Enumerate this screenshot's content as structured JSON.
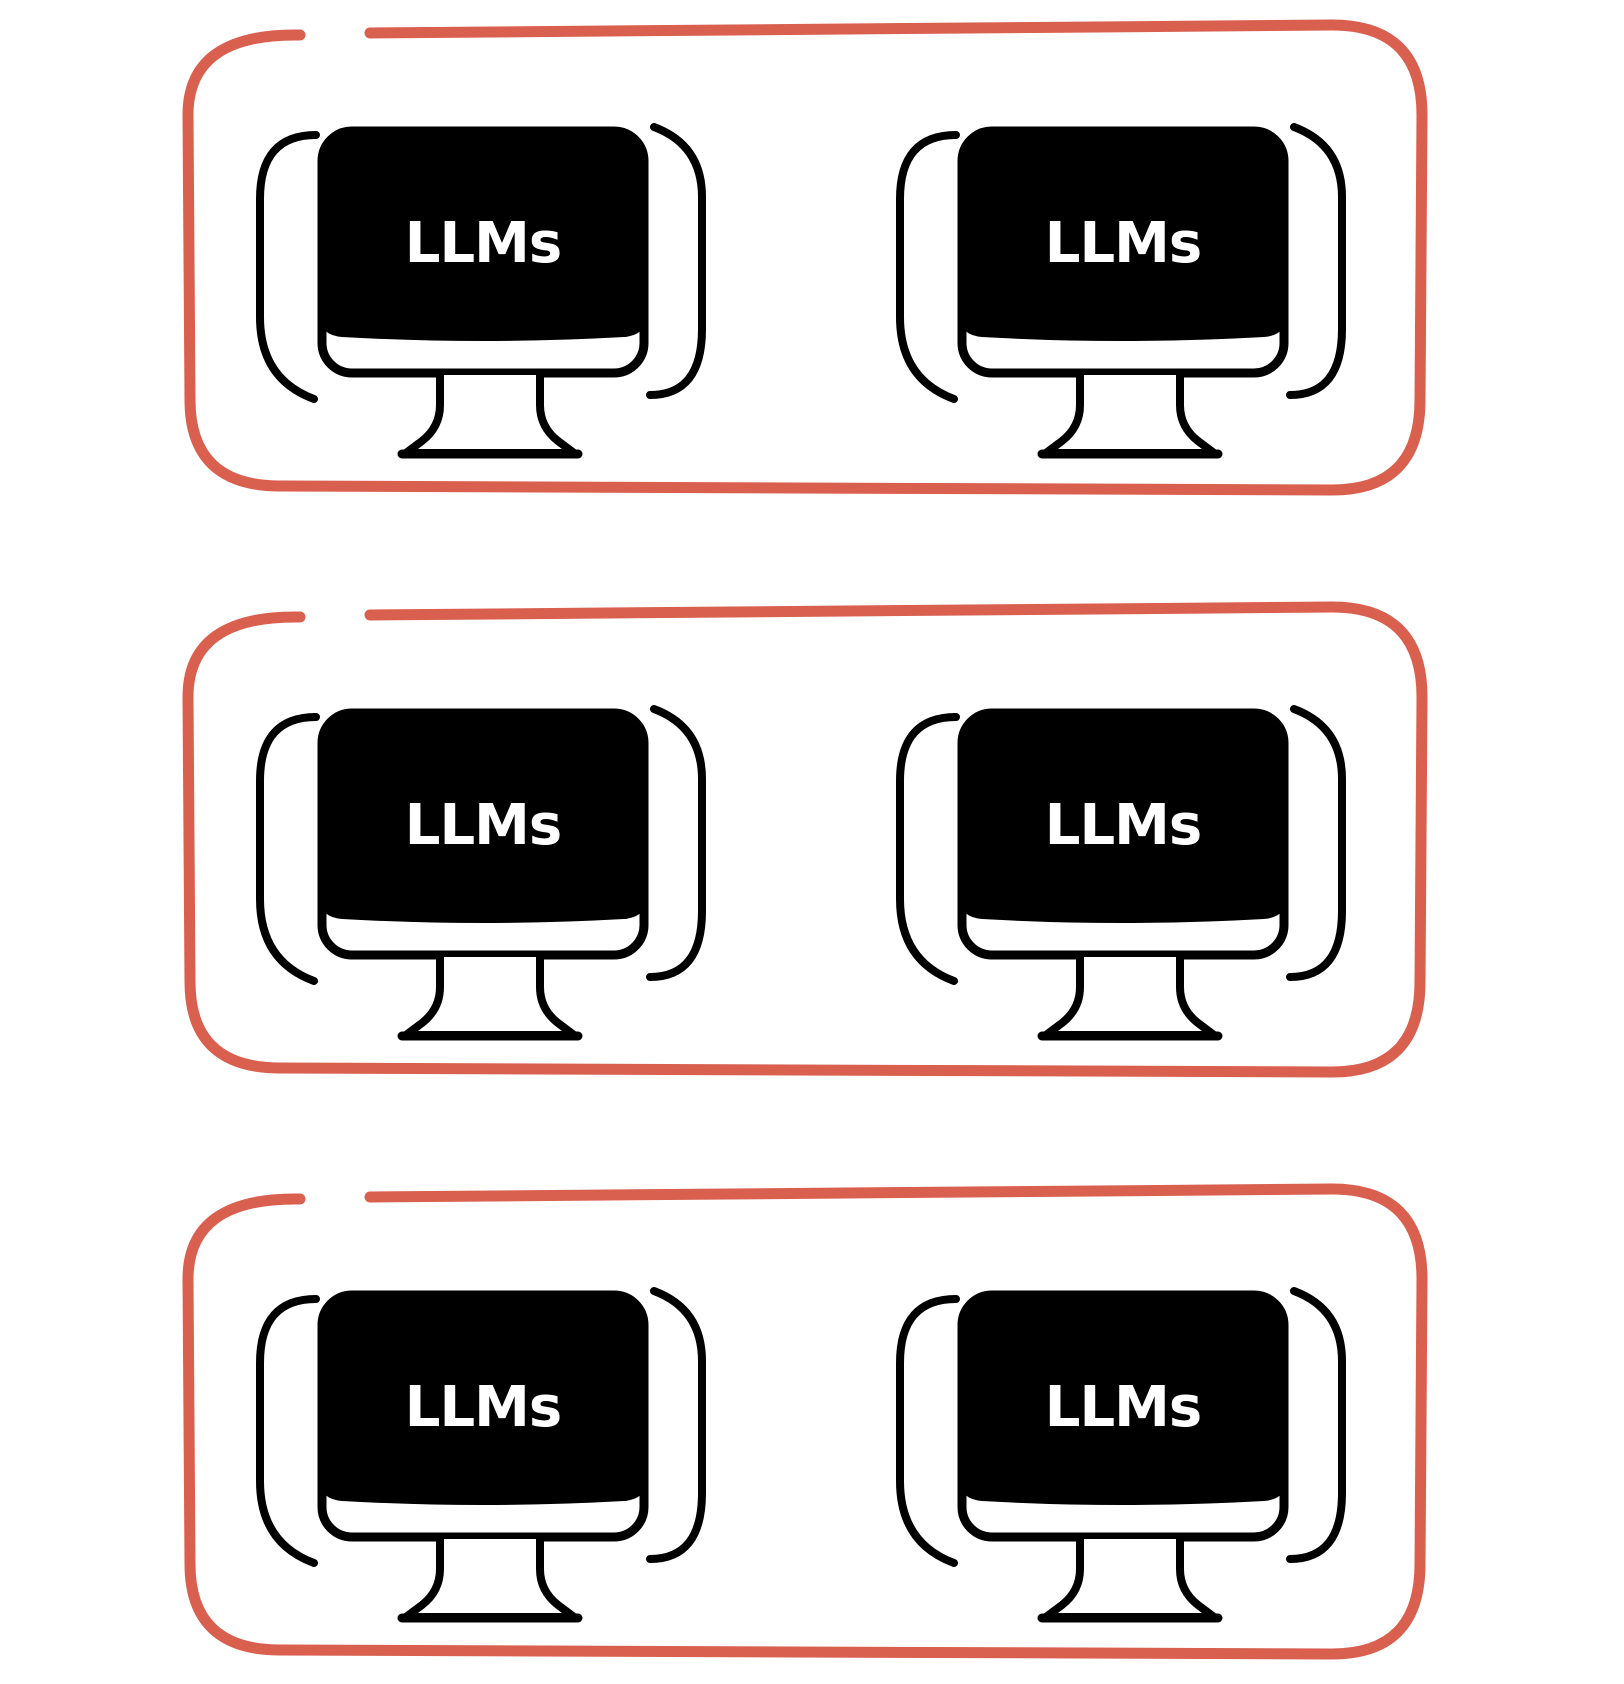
{
  "colors": {
    "background": "#ffffff",
    "group_border": "#d95f4f",
    "monitor": "#000000",
    "screen_text": "#ffffff"
  },
  "groups": [
    {
      "computers": [
        {
          "label": "LLMs",
          "icon": "monitor-icon"
        },
        {
          "label": "LLMs",
          "icon": "monitor-icon"
        }
      ]
    },
    {
      "computers": [
        {
          "label": "LLMs",
          "icon": "monitor-icon"
        },
        {
          "label": "LLMs",
          "icon": "monitor-icon"
        }
      ]
    },
    {
      "computers": [
        {
          "label": "LLMs",
          "icon": "monitor-icon"
        },
        {
          "label": "LLMs",
          "icon": "monitor-icon"
        }
      ]
    }
  ]
}
